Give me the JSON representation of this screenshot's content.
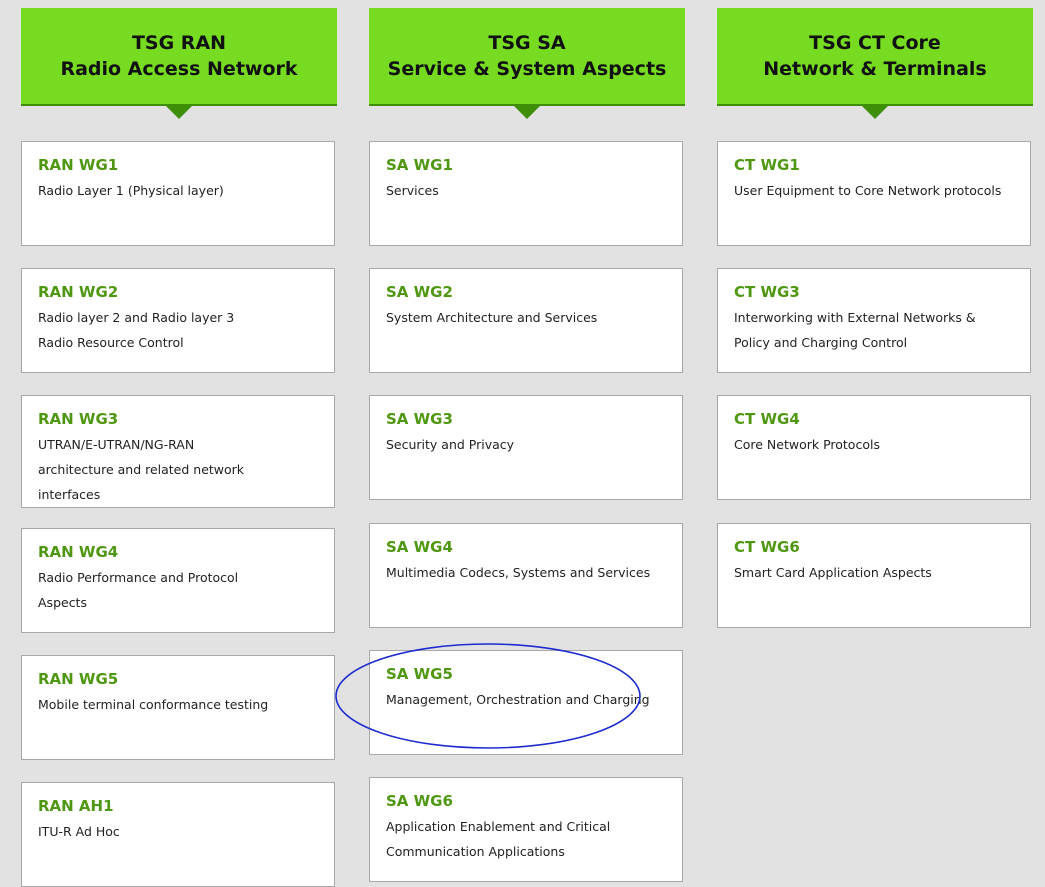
{
  "columns": [
    {
      "title_line1": "TSG RAN",
      "title_line2": "Radio Access Network",
      "groups": [
        {
          "title": "RAN WG1",
          "desc": "Radio Layer 1 (Physical layer)"
        },
        {
          "title": "RAN WG2",
          "desc": "Radio layer 2 and Radio layer 3 Radio Resource Control"
        },
        {
          "title": "RAN WG3",
          "desc": "UTRAN/E-UTRAN/NG-RAN architecture and related network interfaces"
        },
        {
          "title": "RAN WG4",
          "desc": "Radio Performance and Protocol Aspects"
        },
        {
          "title": "RAN WG5",
          "desc": "Mobile terminal conformance testing"
        },
        {
          "title": "RAN AH1",
          "desc": "ITU-R Ad Hoc"
        }
      ]
    },
    {
      "title_line1": "TSG SA",
      "title_line2": "Service & System Aspects",
      "groups": [
        {
          "title": "SA WG1",
          "desc": "Services"
        },
        {
          "title": "SA WG2",
          "desc": "System Architecture and Services"
        },
        {
          "title": "SA WG3",
          "desc": "Security and Privacy"
        },
        {
          "title": "SA WG4",
          "desc": "Multimedia Codecs, Systems and Services"
        },
        {
          "title": "SA WG5",
          "desc": "Management, Orchestration and Charging"
        },
        {
          "title": "SA WG6",
          "desc": "Application Enablement and Critical Communication Applications"
        }
      ]
    },
    {
      "title_line1": "TSG CT Core",
      "title_line2": "Network & Terminals",
      "groups": [
        {
          "title": "CT WG1",
          "desc": "User Equipment to Core Network protocols"
        },
        {
          "title": "CT WG3",
          "desc": "Interworking with External Networks & Policy and Charging Control"
        },
        {
          "title": "CT WG4",
          "desc": "Core Network Protocols"
        },
        {
          "title": "CT WG6",
          "desc": "Smart Card Application Aspects"
        }
      ]
    }
  ],
  "colors": {
    "header_bg": "#76db21",
    "header_border": "#3f8e0a",
    "wg_title": "#4f9711",
    "highlight": "#1d2bd0",
    "page_bg": "#e2e2e2"
  },
  "highlighted_group": "SA WG5"
}
